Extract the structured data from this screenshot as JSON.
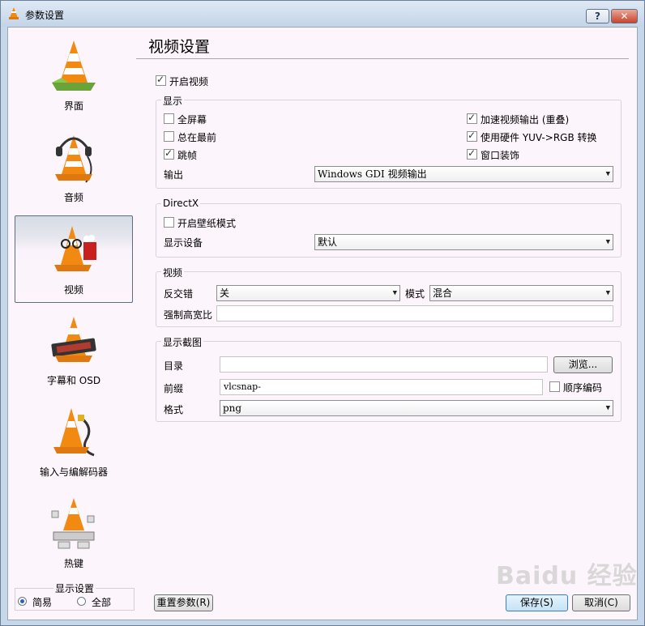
{
  "window": {
    "title": "参数设置",
    "help_label": "?",
    "close_label": "✕"
  },
  "sidebar": {
    "items": [
      {
        "label": "界面",
        "icon": "vlc-cone-interface-icon"
      },
      {
        "label": "音频",
        "icon": "vlc-cone-headphones-icon"
      },
      {
        "label": "视频",
        "icon": "vlc-cone-glasses-icon",
        "selected": true
      },
      {
        "label": "字幕和 OSD",
        "icon": "vlc-cone-subtitle-icon"
      },
      {
        "label": "输入与编解码器",
        "icon": "vlc-cone-cable-icon"
      },
      {
        "label": "热键",
        "icon": "vlc-cone-keyboard-icon"
      }
    ],
    "display_settings": {
      "title": "显示设置",
      "options": [
        {
          "label": "简易",
          "selected": true
        },
        {
          "label": "全部",
          "selected": false
        }
      ]
    }
  },
  "panel": {
    "title": "视频设置",
    "enable_video": {
      "label": "开启视频",
      "checked": true
    },
    "display": {
      "title": "显示",
      "fullscreen": {
        "label": "全屏幕",
        "checked": false
      },
      "always_on_top": {
        "label": "总在最前",
        "checked": false
      },
      "skip_frames": {
        "label": "跳帧",
        "checked": true
      },
      "accelerated_output": {
        "label": "加速视频输出 (重叠)",
        "checked": true
      },
      "hw_yuv_rgb": {
        "label": "使用硬件 YUV->RGB 转换",
        "checked": true
      },
      "window_decorations": {
        "label": "窗口装饰",
        "checked": true
      },
      "output_label": "输出",
      "output_value": "Windows GDI 视频输出"
    },
    "directx": {
      "title": "DirectX",
      "wallpaper_mode": {
        "label": "开启壁纸模式",
        "checked": false
      },
      "device_label": "显示设备",
      "device_value": "默认"
    },
    "video": {
      "title": "视频",
      "deinterlace_label": "反交错",
      "deinterlace_value": "关",
      "mode_label": "模式",
      "mode_value": "混合",
      "aspect_label": "强制高宽比",
      "aspect_value": ""
    },
    "snapshot": {
      "title": "显示截图",
      "directory_label": "目录",
      "directory_value": "",
      "browse_label": "浏览...",
      "prefix_label": "前缀",
      "prefix_value": "vlcsnap-",
      "sequential": {
        "label": "顺序编码",
        "checked": false
      },
      "format_label": "格式",
      "format_value": "png"
    }
  },
  "footer": {
    "reset_label": "重置参数(R)",
    "save_label": "保存(S)",
    "cancel_label": "取消(C)"
  },
  "watermark": "Baidu 经验"
}
